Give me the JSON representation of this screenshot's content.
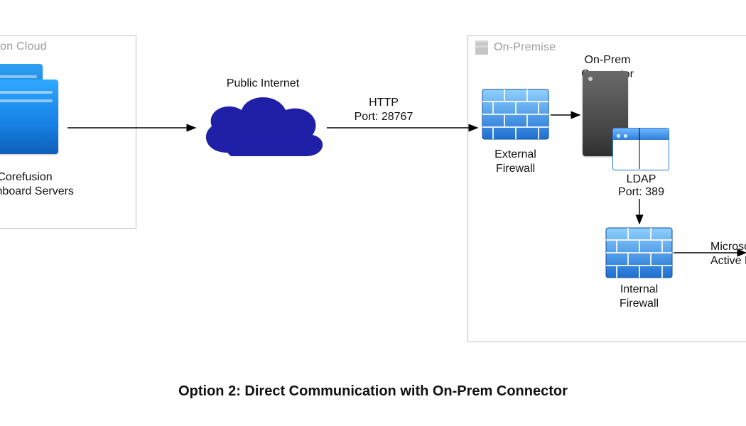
{
  "groups": {
    "cloud_title": "Corefusion Cloud",
    "onprem_title": "On-Premise"
  },
  "nodes": {
    "dashboard_servers": "Corefusion\nDashboard Servers",
    "public_internet": "Public Internet",
    "external_firewall": "External\nFirewall",
    "onprem_connector": "On-Prem\nConnector",
    "ldap_protocol": "LDAP",
    "ldap_port": "Port: 389",
    "internal_firewall": "Internal\nFirewall",
    "active_directory": "Microsoft\nActive Directory"
  },
  "edges": {
    "http_label_line1": "HTTP",
    "http_label_line2": "Port: 28767"
  },
  "caption": "Option 2: Direct Communication with On-Prem Connector",
  "colors": {
    "cloud_fill": "#1f1fa8",
    "firewall_top": "#6fc2ff",
    "firewall_bottom": "#1d6fd1",
    "server_blue_top": "#2fa8ff",
    "server_blue_bottom": "#0f5fb8",
    "tower_dark": "#3a3a3a",
    "group_border": "#bfbfbf",
    "group_title": "#9b9b9b"
  }
}
